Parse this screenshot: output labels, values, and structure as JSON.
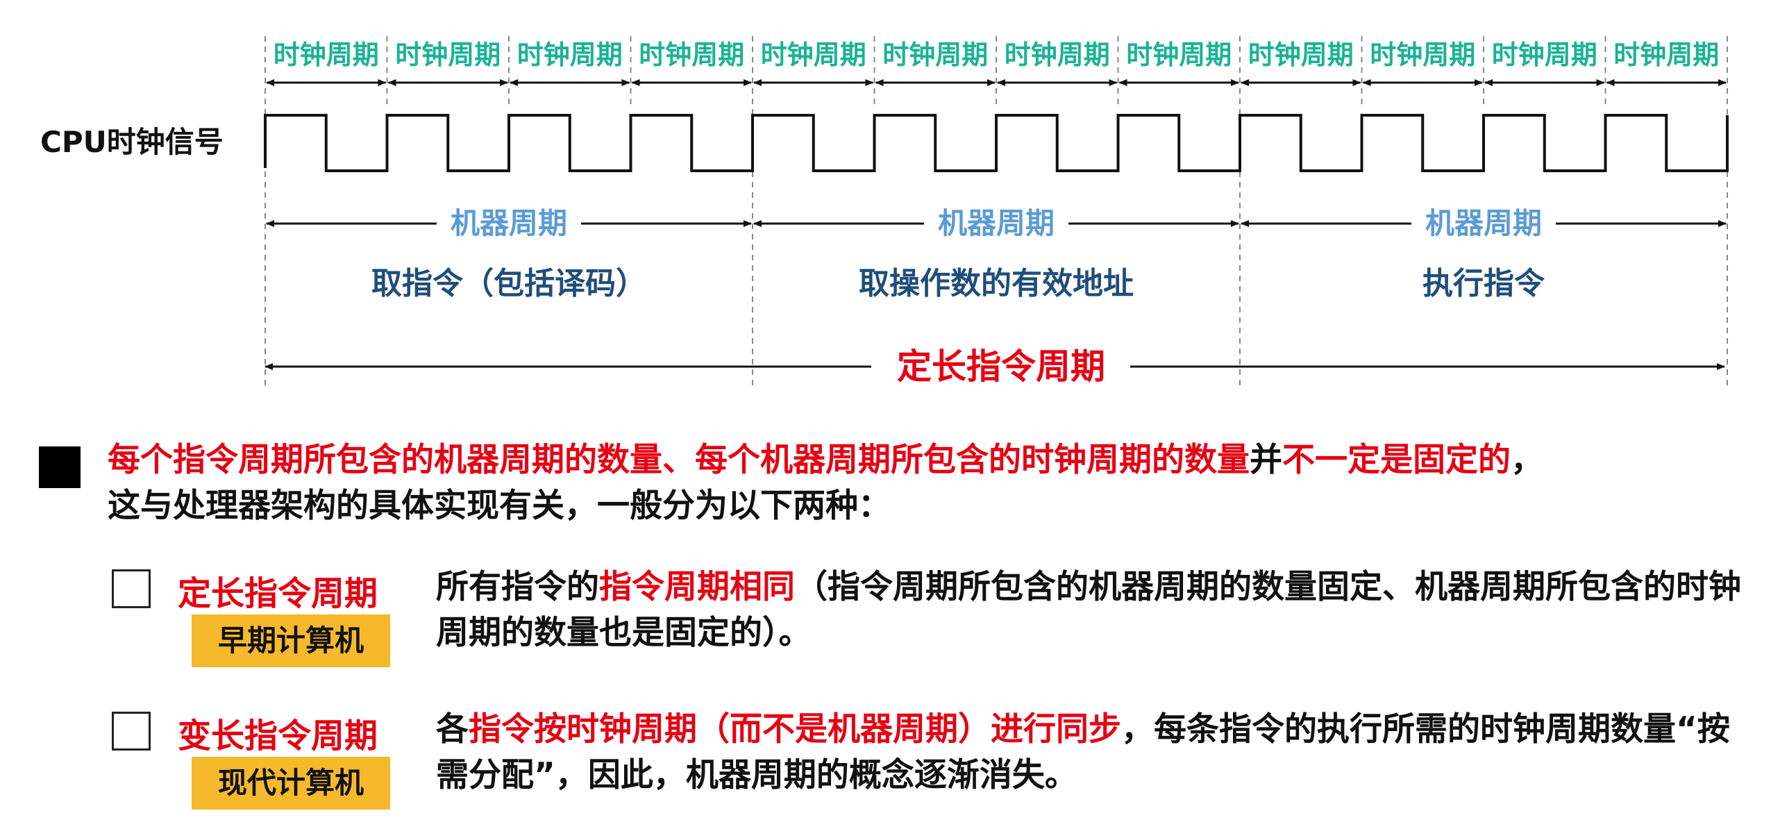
{
  "diagram": {
    "clock_cycle_label": "时钟周期",
    "clock_cycle_count": 12,
    "signal_label": "CPU时钟信号",
    "machine_cycle_label": "机器周期",
    "phases": [
      "取指令（包括译码）",
      "取操作数的有效地址",
      "执行指令"
    ],
    "instruction_cycle_label": "定长指令周期"
  },
  "note": {
    "seg1": "每个指令周期所包含的机器周期的数量",
    "seg2": "、",
    "seg3": "每个机器周期所包含的时钟周期的数量",
    "seg4": "并",
    "seg5": "不一定是固定的",
    "seg6": "，",
    "line2": "这与处理器架构的具体实现有关，一般分为以下两种："
  },
  "types": [
    {
      "label": "定长指令周期",
      "tag": "早期计算机",
      "desc_a": "所有指令的",
      "desc_b": "指令周期相同",
      "desc_c": "（指令周期所包含的机器周期的数量固定、机器周期所包含的时钟周期的数量也是固定的）。"
    },
    {
      "label": "变长指令周期",
      "tag": "现代计算机",
      "desc_a": "各",
      "desc_b": "指令按时钟周期（而不是机器周期）进行同步",
      "desc_c": "，每条指令的执行所需的时钟周期数量“按需分配”，因此，机器周期的概念逐渐消失。"
    }
  ]
}
